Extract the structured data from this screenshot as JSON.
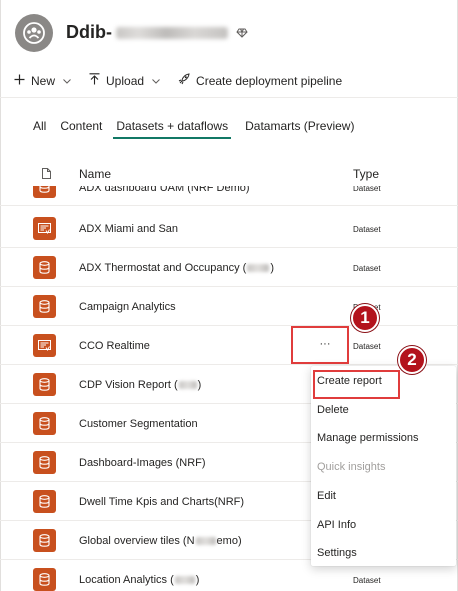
{
  "workspace": {
    "name_prefix": "Ddib-",
    "avatar_icon": "workspace-people-icon",
    "premium_icon": "diamond-icon"
  },
  "toolbar": {
    "new_label": "New",
    "upload_label": "Upload",
    "pipeline_label": "Create deployment pipeline"
  },
  "tabs": [
    {
      "label": "All"
    },
    {
      "label": "Content"
    },
    {
      "label": "Datasets + dataflows"
    },
    {
      "label": "Datamarts (Preview)"
    }
  ],
  "table": {
    "col_name": "Name",
    "col_type": "Type",
    "rows": [
      {
        "name": "ADX dashboard UAM (NRF Demo)",
        "type": "Dataset",
        "icon": "dataset-icon"
      },
      {
        "name": "ADX Miami and San",
        "type": "Dataset",
        "icon": "streaming-dataset-icon"
      },
      {
        "name": "ADX Thermostat and Occupancy (",
        "name_end": ")",
        "type": "Dataset",
        "icon": "dataset-icon"
      },
      {
        "name": "Campaign Analytics",
        "type": "Dataset",
        "icon": "dataset-icon"
      },
      {
        "name": "CCO Realtime",
        "type": "Dataset",
        "icon": "streaming-dataset-icon",
        "more_label": "···"
      },
      {
        "name": "CDP Vision Report (",
        "name_end": ")",
        "type": "",
        "icon": "dataset-icon"
      },
      {
        "name": "Customer Segmentation",
        "type": "",
        "icon": "dataset-icon"
      },
      {
        "name": "Dashboard-Images (NRF)",
        "type": "",
        "icon": "dataset-icon"
      },
      {
        "name": "Dwell Time Kpis and Charts(NRF)",
        "type": "",
        "icon": "dataset-icon"
      },
      {
        "name": "Global overview tiles (N",
        "name_end": "emo)",
        "type": "",
        "icon": "dataset-icon"
      },
      {
        "name": "Location Analytics (",
        "name_end": ")",
        "type": "Dataset",
        "icon": "dataset-icon"
      }
    ]
  },
  "context_menu": {
    "items": [
      {
        "label": "Create report",
        "disabled": false
      },
      {
        "label": "Delete",
        "disabled": false
      },
      {
        "label": "Manage permissions",
        "disabled": false
      },
      {
        "label": "Quick insights",
        "disabled": true
      },
      {
        "label": "Edit",
        "disabled": false
      },
      {
        "label": "API Info",
        "disabled": false
      },
      {
        "label": "Settings",
        "disabled": false
      }
    ]
  },
  "annotations": [
    {
      "label": "1"
    },
    {
      "label": "2"
    }
  ],
  "colors": {
    "accent": "#117865",
    "dataset_icon_bg": "#c8501e",
    "annotation_red": "#e03c3c",
    "badge_red": "#b3121c",
    "disabled_text": "#a19f9d"
  }
}
